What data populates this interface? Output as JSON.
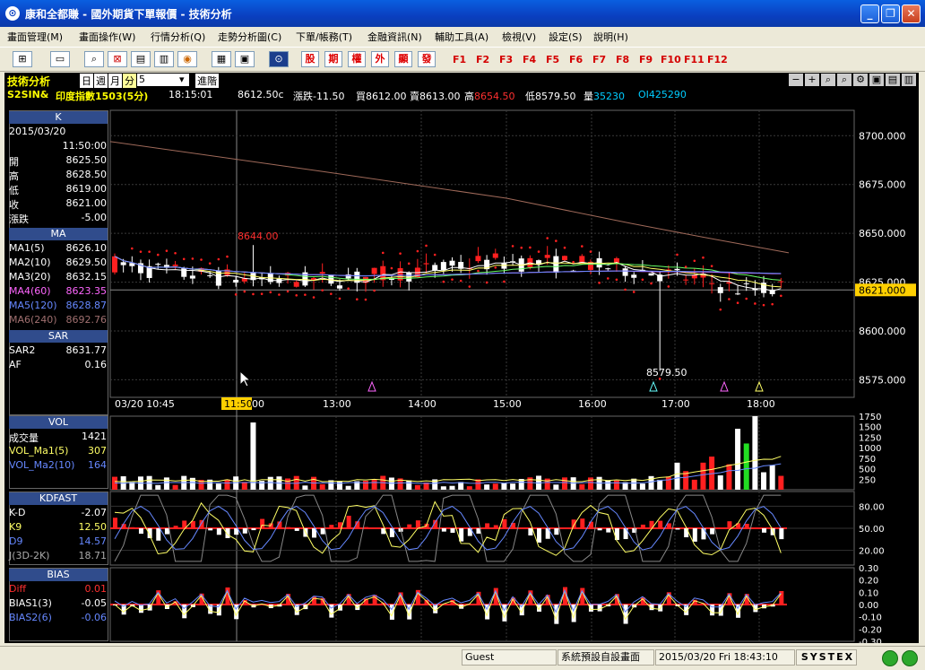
{
  "window": {
    "title": "康和全都賺 - 國外期貨下單報價 - 技術分析",
    "icon": "app-logo-icon"
  },
  "menu": [
    "畫面管理(M)",
    "畫面操作(W)",
    "行情分析(Q)",
    "走勢分析圖(C)",
    "下單/帳務(T)",
    "金融資訊(N)",
    "輔助工具(A)",
    "檢視(V)",
    "設定(S)",
    "說明(H)"
  ],
  "toolbar": {
    "buttons": [
      "股",
      "期",
      "權",
      "外",
      "顯",
      "發"
    ],
    "fkeys": [
      "F1",
      "F2",
      "F3",
      "F4",
      "F5",
      "F6",
      "F7",
      "F8",
      "F9",
      "F10",
      "F11",
      "F12"
    ]
  },
  "chart_header": {
    "title": "技術分析",
    "periods": [
      "日",
      "週",
      "月",
      "分"
    ],
    "interval": "5",
    "advanced": "進階",
    "symbol": "S2SIN&",
    "name": "印度指數1503(5分)",
    "time": "18:15:01",
    "last": "8612.50c",
    "change_label": "漲跌",
    "change": "-11.50",
    "bid_label": "買",
    "bid": "8612.00",
    "ask_label": "賣",
    "ask": "8613.00",
    "high_label": "高",
    "high": "8654.50",
    "low_label": "低",
    "low": "8579.50",
    "volume_label": "量",
    "volume": "35230",
    "oi_label": "OI",
    "oi": "425290"
  },
  "side": {
    "k": {
      "head": "K",
      "date": "2015/03/20",
      "time": "11:50:00",
      "rows": [
        {
          "k": "開",
          "v": "8625.50"
        },
        {
          "k": "高",
          "v": "8628.50"
        },
        {
          "k": "低",
          "v": "8619.00"
        },
        {
          "k": "收",
          "v": "8621.00"
        },
        {
          "k": "漲跌",
          "v": "-5.00"
        }
      ]
    },
    "ma": {
      "head": "MA",
      "rows": [
        {
          "k": "MA1(5)",
          "v": "8626.10",
          "c": "#ffffff"
        },
        {
          "k": "MA2(10)",
          "v": "8629.50",
          "c": "#ffffff"
        },
        {
          "k": "MA3(20)",
          "v": "8632.15",
          "c": "#ffffff"
        },
        {
          "k": "MA4(60)",
          "v": "8623.35",
          "c": "#ff66ff"
        },
        {
          "k": "MA5(120)",
          "v": "8628.87",
          "c": "#6688ff"
        },
        {
          "k": "MA6(240)",
          "v": "8692.76",
          "c": "#a07070"
        }
      ]
    },
    "sar": {
      "head": "SAR",
      "rows": [
        {
          "k": "SAR2",
          "v": "8631.77"
        },
        {
          "k": "AF",
          "v": "0.16"
        }
      ]
    },
    "vol": {
      "head": "VOL",
      "rows": [
        {
          "k": "成交量",
          "v": "1421",
          "c": "#ffffff"
        },
        {
          "k": "VOL_Ma1(5)",
          "v": "307",
          "c": "#ffff66"
        },
        {
          "k": "VOL_Ma2(10)",
          "v": "164",
          "c": "#6688ff"
        }
      ]
    },
    "kd": {
      "head": "KDFAST",
      "rows": [
        {
          "k": "K-D",
          "v": "-2.07",
          "c": "#ffffff"
        },
        {
          "k": "K9",
          "v": "12.50",
          "c": "#ffff66"
        },
        {
          "k": "D9",
          "v": "14.57",
          "c": "#6688ff"
        },
        {
          "k": "J(3D-2K)",
          "v": "18.71",
          "c": "#aaaaaa"
        }
      ]
    },
    "bias": {
      "head": "BIAS",
      "rows": [
        {
          "k": "Diff",
          "v": "0.01",
          "c": "#ff3030"
        },
        {
          "k": "BIAS1(3)",
          "v": "-0.05",
          "c": "#ffffff"
        },
        {
          "k": "BIAS2(6)",
          "v": "-0.06",
          "c": "#6688ff"
        }
      ]
    }
  },
  "price_axis": [
    "8700.000",
    "8675.000",
    "8650.000",
    "8625.000",
    "8600.000",
    "8575.000"
  ],
  "last_price_tag": "8621.000",
  "time_axis": [
    "03/20 10:45",
    "11:50",
    "00",
    "13:00",
    "14:00",
    "15:00",
    "16:00",
    "17:00",
    "18:00"
  ],
  "annotations": {
    "max": "8644.00",
    "min": "8579.50"
  },
  "vol_axis": [
    "1750",
    "1500",
    "1250",
    "1000",
    "750",
    "500",
    "250"
  ],
  "kd_axis": [
    "80.00",
    "50.00",
    "20.00"
  ],
  "bias_axis": [
    "0.30",
    "0.20",
    "0.10",
    "0.00",
    "-0.10",
    "-0.20",
    "-0.30"
  ],
  "status": {
    "user": "Guest",
    "layout": "系統預設自設畫面",
    "datetime": "2015/03/20 Fri 18:43:10",
    "brand": "SYSTEX"
  },
  "chart_data": {
    "type": "candlestick",
    "title": "印度指數1503(5分)",
    "ylim": [
      8566,
      8713
    ],
    "x_ticks": [
      "03/20 10:45",
      "11:50",
      "13:00",
      "14:00",
      "15:00",
      "16:00",
      "17:00",
      "18:00"
    ],
    "last_bar": {
      "time": "11:50:00",
      "open": 8625.5,
      "high": 8628.5,
      "low": 8619.0,
      "close": 8621.0,
      "change": -5.0
    },
    "session_high": 8654.5,
    "session_low": 8579.5,
    "marked_high": 8644.0,
    "marked_low": 8579.5,
    "indicators": {
      "MA1(5)": 8626.1,
      "MA2(10)": 8629.5,
      "MA3(20)": 8632.15,
      "MA4(60)": 8623.35,
      "MA5(120)": 8628.87,
      "MA6(240)": 8692.76,
      "SAR2": 8631.77,
      "AF": 0.16,
      "volume": 1421,
      "VOL_Ma1(5)": 307,
      "VOL_Ma2(10)": 164,
      "K-D": -2.07,
      "K9": 12.5,
      "D9": 14.57,
      "J(3D-2K)": 18.71,
      "Diff": 0.01,
      "BIAS1(3)": -0.05,
      "BIAS2(6)": -0.06
    }
  }
}
